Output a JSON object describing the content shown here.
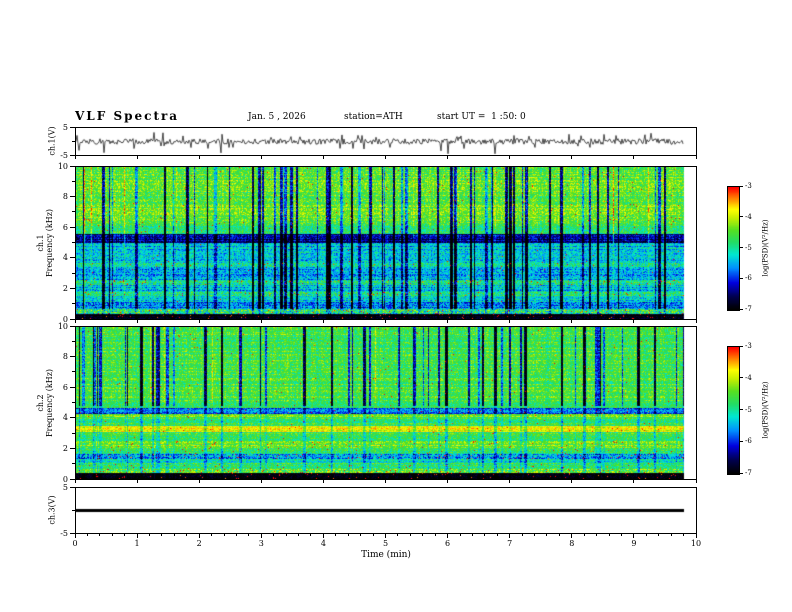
{
  "header": {
    "title": "VLF Spectra",
    "date": "Jan. 5 , 2026",
    "station": "station=ATH",
    "start_ut": "start UT =  1 :50: 0"
  },
  "time_axis": {
    "label": "Time (min)",
    "min": 0,
    "max": 10,
    "ticks": [
      "0",
      "1",
      "2",
      "3",
      "4",
      "5",
      "6",
      "7",
      "8",
      "9",
      "10"
    ],
    "minor_step_min": 0.2,
    "data_end_min": 9.8
  },
  "panels": {
    "waveform": {
      "channel": "ch.1(V)",
      "ymin": -5,
      "ymax": 5,
      "ytick_labels": [
        "5",
        "-5"
      ],
      "seed": 20260105,
      "noise_amp_v": 1.05,
      "mid_spike_prob": 0.05,
      "big_spike_prob": 0.012,
      "spike_max_v": 4.8
    },
    "spec1": {
      "label_lines": [
        "ch.1",
        "Frequency (kHz)"
      ],
      "fmin": 0,
      "fmax": 10,
      "ytick_labels": [
        "0",
        "2",
        "4",
        "6",
        "8",
        "10"
      ],
      "seed": 51,
      "streak_prob": 0.09,
      "bright_prob": 0.02,
      "bright_amp": 0.7,
      "streak_depth": [
        1.0,
        2.8
      ],
      "streak_full_fmin": 0.6,
      "streak_partial": 0.25,
      "bands": [
        [
          0.0,
          0.3,
          -7.0,
          0.25,
          0.025
        ],
        [
          0.3,
          0.6,
          -4.9,
          0.85,
          0.02
        ],
        [
          0.6,
          1.1,
          -5.6,
          0.55,
          0.0
        ],
        [
          1.1,
          1.5,
          -5.25,
          0.5,
          0.004
        ],
        [
          1.5,
          1.75,
          -4.95,
          0.6,
          0.018
        ],
        [
          1.75,
          2.2,
          -5.35,
          0.5,
          0.0
        ],
        [
          2.2,
          2.55,
          -4.95,
          0.6,
          0.018
        ],
        [
          2.55,
          3.4,
          -5.45,
          0.5,
          0.002
        ],
        [
          3.4,
          3.65,
          -5.05,
          0.55,
          0.012
        ],
        [
          3.65,
          5.0,
          -5.35,
          0.5,
          0.002
        ],
        [
          5.0,
          5.6,
          -6.35,
          0.45,
          0.0
        ],
        [
          5.6,
          6.2,
          -4.75,
          0.5,
          0.005
        ],
        [
          6.2,
          10.01,
          -4.45,
          0.5,
          0.007
        ]
      ]
    },
    "spec2": {
      "label_lines": [
        "ch.2",
        "Frequency (kHz)"
      ],
      "fmin": 0,
      "fmax": 10,
      "ytick_labels": [
        "0",
        "2",
        "4",
        "6",
        "8",
        "10"
      ],
      "seed": 52,
      "streak_prob": 0.08,
      "bright_prob": 0.01,
      "bright_amp": 0.5,
      "streak_depth": [
        1.2,
        3.0
      ],
      "streak_full_fmin": 4.8,
      "streak_partial": 0.3,
      "bands": [
        [
          0.0,
          0.35,
          -7.0,
          0.25,
          0.02
        ],
        [
          0.35,
          0.65,
          -4.55,
          0.7,
          0.03
        ],
        [
          0.65,
          1.0,
          -4.75,
          0.5,
          0.01
        ],
        [
          1.0,
          1.3,
          -5.05,
          0.5,
          0.0
        ],
        [
          1.3,
          1.6,
          -5.5,
          0.6,
          0.03
        ],
        [
          1.6,
          2.0,
          -4.8,
          0.5,
          0.01
        ],
        [
          2.0,
          2.5,
          -4.35,
          0.5,
          0.02
        ],
        [
          2.5,
          3.1,
          -4.7,
          0.45,
          0.005
        ],
        [
          3.1,
          3.5,
          -3.85,
          0.35,
          0.01
        ],
        [
          3.5,
          4.1,
          -4.7,
          0.45,
          0.005
        ],
        [
          4.1,
          4.3,
          -4.25,
          0.45,
          0.012
        ],
        [
          4.3,
          4.65,
          -5.8,
          0.5,
          0.012
        ],
        [
          4.65,
          5.0,
          -4.7,
          0.4,
          0.003
        ],
        [
          5.0,
          10.01,
          -4.6,
          0.45,
          0.004
        ]
      ]
    },
    "ch3": {
      "channel": "ch.3(V)",
      "ymin": -5,
      "ymax": 5,
      "ytick_labels": [
        "5",
        "-5"
      ],
      "line_value": 0
    }
  },
  "colorbar": {
    "label": "log(PSD)(V²/Hz)",
    "zmin": -7,
    "zmax": -3,
    "ticks": [
      "-3",
      "-4",
      "-5",
      "-6",
      "-7"
    ],
    "stops": [
      [
        0.0,
        "#000000"
      ],
      [
        0.1,
        "#00004a"
      ],
      [
        0.22,
        "#0000e0"
      ],
      [
        0.34,
        "#0090ff"
      ],
      [
        0.45,
        "#00e8d0"
      ],
      [
        0.55,
        "#22dd66"
      ],
      [
        0.65,
        "#55e022"
      ],
      [
        0.75,
        "#c8f000"
      ],
      [
        0.82,
        "#ffff00"
      ],
      [
        0.9,
        "#ff9000"
      ],
      [
        1.0,
        "#ff0000"
      ]
    ]
  },
  "chart_data": [
    {
      "type": "line",
      "title": "ch.1(V) time series",
      "xlabel": "Time (min)",
      "ylabel": "ch.1(V)",
      "xlim": [
        0,
        10
      ],
      "ylim": [
        -5,
        5
      ],
      "data_extent_x": [
        0,
        9.8
      ],
      "description": "Broadband noise of roughly ±1 V about zero with frequent impulsive spikes reaching about ±4 to ±5 V throughout the record."
    },
    {
      "type": "heatmap",
      "title": "ch.1 VLF spectrogram",
      "xlabel": "Time (min)",
      "ylabel": "Frequency (kHz)",
      "zlabel": "log(PSD)(V²/Hz)",
      "xlim": [
        0,
        10
      ],
      "ylim": [
        0,
        10
      ],
      "zlim": [
        -7,
        -3
      ],
      "features": [
        "black no-signal band below ~0.3 kHz",
        "speckled multicolor row near 0.3-0.6 kHz",
        "blue-cyan background 1-5 kHz (PSD ~ 10^-5.4)",
        "dark-blue quiet band 5.0-5.6 kHz",
        "green-yellow background 5.6-10 kHz (PSD ~ 10^-4.4)",
        "dense vertical blue/black dropout streaks at all times",
        "red speckle lines near 1.6, 2.3 and 3.5 kHz"
      ]
    },
    {
      "type": "heatmap",
      "title": "ch.2 VLF spectrogram",
      "xlabel": "Time (min)",
      "ylabel": "Frequency (kHz)",
      "zlabel": "log(PSD)(V²/Hz)",
      "xlim": [
        0,
        10
      ],
      "ylim": [
        0,
        10
      ],
      "zlim": [
        -7,
        -3
      ],
      "features": [
        "black no-signal band below ~0.35 kHz",
        "bright yellow band 3.1-3.5 kHz (PSD ~ 10^-3.8)",
        "yellow lines near 2.0-2.5 and 4.1-4.3 kHz",
        "dark band 4.3-4.65 kHz",
        "green background (PSD ~ 10^-4.6) above 5 kHz with deep-blue vertical streaks",
        "red speckles near 0.5 and 1.3-1.6 kHz"
      ]
    },
    {
      "type": "line",
      "title": "ch.3(V) time series",
      "xlabel": "Time (min)",
      "ylabel": "ch.3(V)",
      "xlim": [
        0,
        10
      ],
      "ylim": [
        -5,
        5
      ],
      "data_extent_x": [
        0,
        9.8
      ],
      "description": "Constant 0 V flat thick line (no signal on channel 3)."
    }
  ]
}
